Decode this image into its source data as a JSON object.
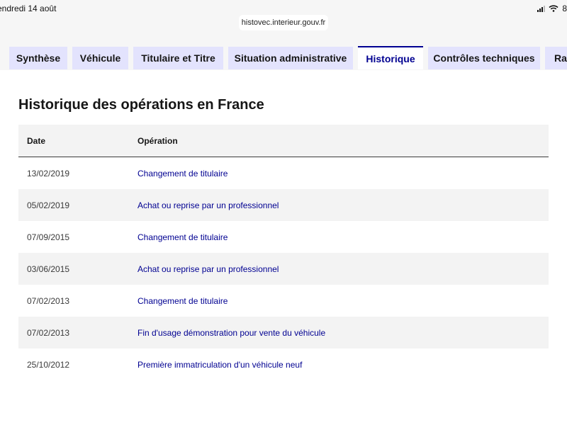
{
  "status": {
    "time": "endredi 14 août",
    "battery": "8"
  },
  "browser": {
    "url": "histovec.interieur.gouv.fr"
  },
  "tabs": [
    {
      "label": "Synthèse",
      "active": false
    },
    {
      "label": "Véhicule",
      "active": false
    },
    {
      "label": "Titulaire et Titre",
      "active": false
    },
    {
      "label": "Situation administrative",
      "active": false
    },
    {
      "label": "Historique",
      "active": true
    },
    {
      "label": "Contrôles techniques",
      "active": false
    },
    {
      "label": "Rap",
      "active": false
    }
  ],
  "history": {
    "title": "Historique des opérations en France",
    "columns": {
      "date": "Date",
      "operation": "Opération"
    },
    "rows": [
      {
        "date": "13/02/2019",
        "operation": "Changement de titulaire"
      },
      {
        "date": "05/02/2019",
        "operation": "Achat ou reprise par un professionnel"
      },
      {
        "date": "07/09/2015",
        "operation": "Changement de titulaire"
      },
      {
        "date": "03/06/2015",
        "operation": "Achat ou reprise par un professionnel"
      },
      {
        "date": "07/02/2013",
        "operation": "Changement de titulaire"
      },
      {
        "date": "07/02/2013",
        "operation": "Fin d'usage démonstration pour vente du véhicule"
      },
      {
        "date": "25/10/2012",
        "operation": "Première immatriculation d'un véhicule neuf"
      }
    ]
  },
  "colors": {
    "accent": "#000091",
    "tab_bg": "#e3e3fd",
    "row_alt": "#f3f3f3"
  },
  "icons": [
    "signal-icon",
    "wifi-icon"
  ]
}
